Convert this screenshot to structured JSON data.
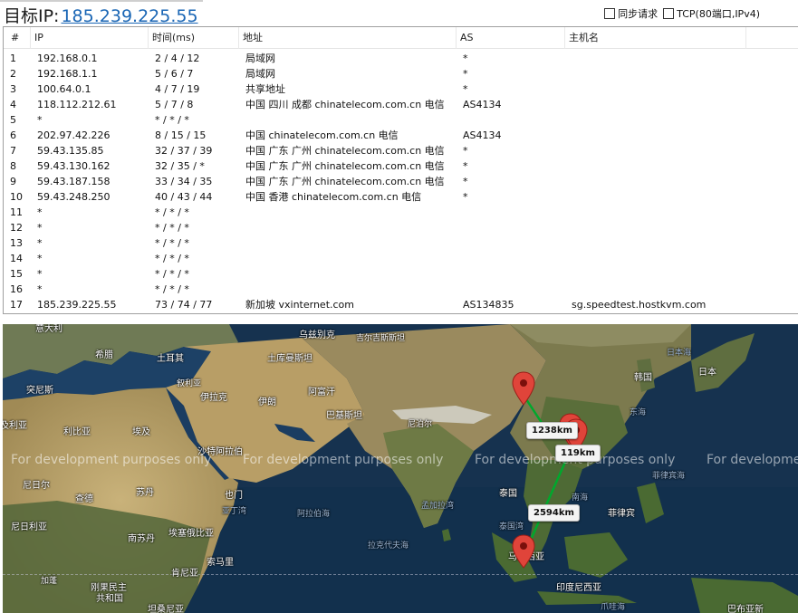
{
  "header": {
    "target_label": "目标IP:",
    "target_ip": "185.239.225.55",
    "sync_label": "同步请求",
    "tcp_label": "TCP(80端口,IPv4)"
  },
  "table": {
    "columns": [
      "#",
      "IP",
      "时间(ms)",
      "地址",
      "AS",
      "主机名"
    ],
    "rows": [
      {
        "n": "1",
        "ip": "192.168.0.1",
        "time": "2 / 4 / 12",
        "addr": "局域网",
        "as": "*",
        "host": ""
      },
      {
        "n": "2",
        "ip": "192.168.1.1",
        "time": "5 / 6 / 7",
        "addr": "局域网",
        "as": "*",
        "host": ""
      },
      {
        "n": "3",
        "ip": "100.64.0.1",
        "time": "4 / 7 / 19",
        "addr": "共享地址",
        "as": "*",
        "host": ""
      },
      {
        "n": "4",
        "ip": "118.112.212.61",
        "time": "5 / 7 / 8",
        "addr": "中国 四川 成都 chinatelecom.com.cn 电信",
        "as": "AS4134",
        "host": ""
      },
      {
        "n": "5",
        "ip": "*",
        "time": "* / * / *",
        "addr": "",
        "as": "",
        "host": ""
      },
      {
        "n": "6",
        "ip": "202.97.42.226",
        "time": "8 / 15 / 15",
        "addr": "中国 chinatelecom.com.cn 电信",
        "as": "AS4134",
        "host": ""
      },
      {
        "n": "7",
        "ip": "59.43.135.85",
        "time": "32 / 37 / 39",
        "addr": "中国 广东 广州 chinatelecom.com.cn 电信",
        "as": "*",
        "host": ""
      },
      {
        "n": "8",
        "ip": "59.43.130.162",
        "time": "32 / 35 / *",
        "addr": "中国 广东 广州 chinatelecom.com.cn 电信",
        "as": "*",
        "host": ""
      },
      {
        "n": "9",
        "ip": "59.43.187.158",
        "time": "33 / 34 / 35",
        "addr": "中国 广东 广州 chinatelecom.com.cn 电信",
        "as": "*",
        "host": ""
      },
      {
        "n": "10",
        "ip": "59.43.248.250",
        "time": "40 / 43 / 44",
        "addr": "中国 香港 chinatelecom.com.cn 电信",
        "as": "*",
        "host": ""
      },
      {
        "n": "11",
        "ip": "*",
        "time": "* / * / *",
        "addr": "",
        "as": "",
        "host": ""
      },
      {
        "n": "12",
        "ip": "*",
        "time": "* / * / *",
        "addr": "",
        "as": "",
        "host": ""
      },
      {
        "n": "13",
        "ip": "*",
        "time": "* / * / *",
        "addr": "",
        "as": "",
        "host": ""
      },
      {
        "n": "14",
        "ip": "*",
        "time": "* / * / *",
        "addr": "",
        "as": "",
        "host": ""
      },
      {
        "n": "15",
        "ip": "*",
        "time": "* / * / *",
        "addr": "",
        "as": "",
        "host": ""
      },
      {
        "n": "16",
        "ip": "*",
        "time": "* / * / *",
        "addr": "",
        "as": "",
        "host": ""
      },
      {
        "n": "17",
        "ip": "185.239.225.55",
        "time": "73 / 74 / 77",
        "addr": "新加坡 vxinternet.com",
        "as": "AS134835",
        "host": "sg.speedtest.hostkvm.com"
      }
    ]
  },
  "map": {
    "watermark": "For development purposes only",
    "labels": {
      "italy": "意大利",
      "greece": "希腊",
      "turkey": "土耳其",
      "uzbekistan": "乌兹别克",
      "kyrgyzstan": "吉尔吉斯斯坦",
      "turkmenistan": "土库曼斯坦",
      "japan_sea": "日本海",
      "korea": "韩国",
      "japan": "日本",
      "tunisia": "突尼斯",
      "syria": "叙利亚",
      "iraq": "伊拉克",
      "iran": "伊朗",
      "afghanistan": "阿富汗",
      "pakistan": "巴基斯坦",
      "east_sea": "东海",
      "libya": "利比亚",
      "egypt": "埃及",
      "nepal": "尼泊尔",
      "algeria": "及利亚",
      "saudi": "沙特阿拉伯",
      "niger": "尼日尔",
      "chad": "查德",
      "sudan": "苏丹",
      "yemen": "也门",
      "aden": "亚丁湾",
      "arabian_sea": "阿拉伯海",
      "bay_bengal": "孟加拉湾",
      "thailand": "泰国",
      "south_sea": "南海",
      "philippines": "菲律宾",
      "philippine_sea": "菲律宾海",
      "nigeria": "尼日利亚",
      "south_sudan": "南苏丹",
      "ethiopia": "埃塞俄比亚",
      "somalia": "索马里",
      "laccadive": "拉克代夫海",
      "gulf_thailand": "泰国湾",
      "malaysia": "马来西亚",
      "gabon": "加蓬",
      "kenya": "肯尼亚",
      "drc": "刚果民主\n共和国",
      "tanzania": "坦桑尼亚",
      "indonesia": "印度尼西亚",
      "java_sea": "爪哇海",
      "png": "巴布亚新"
    },
    "distances": {
      "d1": "1238km",
      "d2": "119km",
      "d3": "2594km"
    }
  }
}
